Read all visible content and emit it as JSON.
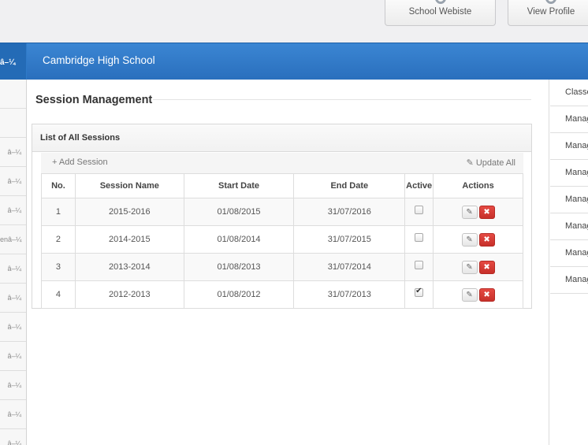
{
  "topbar": {
    "website_label": "School Webiste",
    "profile_label": "View Profile"
  },
  "header": {
    "left_label": "â–¼",
    "school_name": "Cambridge High School"
  },
  "sidebar": {
    "items": [
      "",
      "",
      "â–¼",
      "â–¼",
      "â–¼",
      "enâ–¼",
      "â–¼",
      "â–¼",
      "â–¼",
      "â–¼",
      "â–¼",
      "â–¼",
      "â–¼"
    ]
  },
  "page": {
    "title": "Session Management",
    "panel_title": "List of All Sessions",
    "add_label": "+ Add Session",
    "update_label": "✎ Update All"
  },
  "table": {
    "headers": [
      "No.",
      "Session Name",
      "Start Date",
      "End Date",
      "Active",
      "Actions"
    ],
    "rows": [
      {
        "no": "1",
        "name": "2015-2016",
        "start": "01/08/2015",
        "end": "31/07/2016",
        "active": false
      },
      {
        "no": "2",
        "name": "2014-2015",
        "start": "01/08/2014",
        "end": "31/07/2015",
        "active": false
      },
      {
        "no": "3",
        "name": "2013-2014",
        "start": "01/08/2013",
        "end": "31/07/2014",
        "active": false
      },
      {
        "no": "4",
        "name": "2012-2013",
        "start": "01/08/2012",
        "end": "31/07/2013",
        "active": true
      }
    ],
    "edit_icon": "✎",
    "delete_icon": "✖"
  },
  "right_panel": {
    "items": [
      "Classes",
      "Manage",
      "Manage",
      "Manage",
      "Manage",
      "Manage",
      "Manage",
      "Manage"
    ]
  },
  "colors": {
    "header_blue": "#2f78c4",
    "delete_red": "#d5362f"
  }
}
